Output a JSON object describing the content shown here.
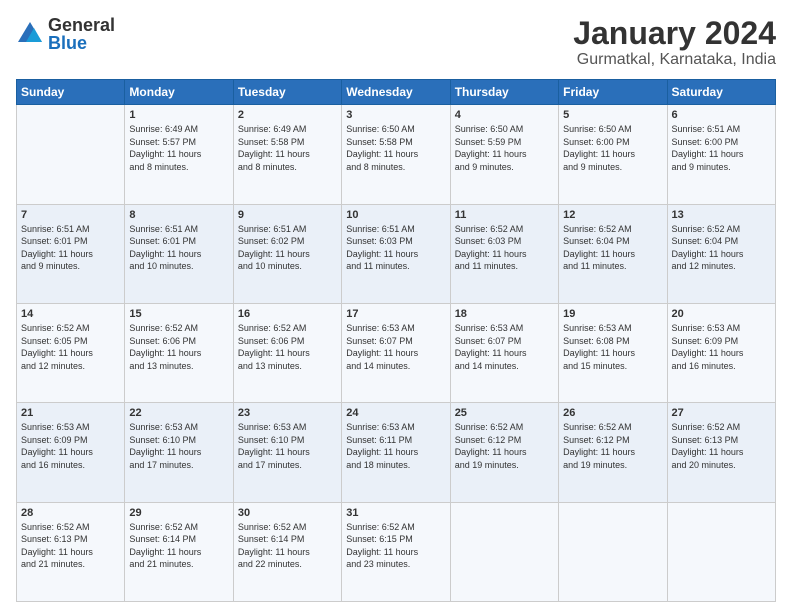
{
  "logo": {
    "general": "General",
    "blue": "Blue"
  },
  "header": {
    "month": "January 2024",
    "location": "Gurmatkal, Karnataka, India"
  },
  "days_of_week": [
    "Sunday",
    "Monday",
    "Tuesday",
    "Wednesday",
    "Thursday",
    "Friday",
    "Saturday"
  ],
  "weeks": [
    [
      {
        "day": "",
        "info": ""
      },
      {
        "day": "1",
        "info": "Sunrise: 6:49 AM\nSunset: 5:57 PM\nDaylight: 11 hours\nand 8 minutes."
      },
      {
        "day": "2",
        "info": "Sunrise: 6:49 AM\nSunset: 5:58 PM\nDaylight: 11 hours\nand 8 minutes."
      },
      {
        "day": "3",
        "info": "Sunrise: 6:50 AM\nSunset: 5:58 PM\nDaylight: 11 hours\nand 8 minutes."
      },
      {
        "day": "4",
        "info": "Sunrise: 6:50 AM\nSunset: 5:59 PM\nDaylight: 11 hours\nand 9 minutes."
      },
      {
        "day": "5",
        "info": "Sunrise: 6:50 AM\nSunset: 6:00 PM\nDaylight: 11 hours\nand 9 minutes."
      },
      {
        "day": "6",
        "info": "Sunrise: 6:51 AM\nSunset: 6:00 PM\nDaylight: 11 hours\nand 9 minutes."
      }
    ],
    [
      {
        "day": "7",
        "info": "Sunrise: 6:51 AM\nSunset: 6:01 PM\nDaylight: 11 hours\nand 9 minutes."
      },
      {
        "day": "8",
        "info": "Sunrise: 6:51 AM\nSunset: 6:01 PM\nDaylight: 11 hours\nand 10 minutes."
      },
      {
        "day": "9",
        "info": "Sunrise: 6:51 AM\nSunset: 6:02 PM\nDaylight: 11 hours\nand 10 minutes."
      },
      {
        "day": "10",
        "info": "Sunrise: 6:51 AM\nSunset: 6:03 PM\nDaylight: 11 hours\nand 11 minutes."
      },
      {
        "day": "11",
        "info": "Sunrise: 6:52 AM\nSunset: 6:03 PM\nDaylight: 11 hours\nand 11 minutes."
      },
      {
        "day": "12",
        "info": "Sunrise: 6:52 AM\nSunset: 6:04 PM\nDaylight: 11 hours\nand 11 minutes."
      },
      {
        "day": "13",
        "info": "Sunrise: 6:52 AM\nSunset: 6:04 PM\nDaylight: 11 hours\nand 12 minutes."
      }
    ],
    [
      {
        "day": "14",
        "info": "Sunrise: 6:52 AM\nSunset: 6:05 PM\nDaylight: 11 hours\nand 12 minutes."
      },
      {
        "day": "15",
        "info": "Sunrise: 6:52 AM\nSunset: 6:06 PM\nDaylight: 11 hours\nand 13 minutes."
      },
      {
        "day": "16",
        "info": "Sunrise: 6:52 AM\nSunset: 6:06 PM\nDaylight: 11 hours\nand 13 minutes."
      },
      {
        "day": "17",
        "info": "Sunrise: 6:53 AM\nSunset: 6:07 PM\nDaylight: 11 hours\nand 14 minutes."
      },
      {
        "day": "18",
        "info": "Sunrise: 6:53 AM\nSunset: 6:07 PM\nDaylight: 11 hours\nand 14 minutes."
      },
      {
        "day": "19",
        "info": "Sunrise: 6:53 AM\nSunset: 6:08 PM\nDaylight: 11 hours\nand 15 minutes."
      },
      {
        "day": "20",
        "info": "Sunrise: 6:53 AM\nSunset: 6:09 PM\nDaylight: 11 hours\nand 16 minutes."
      }
    ],
    [
      {
        "day": "21",
        "info": "Sunrise: 6:53 AM\nSunset: 6:09 PM\nDaylight: 11 hours\nand 16 minutes."
      },
      {
        "day": "22",
        "info": "Sunrise: 6:53 AM\nSunset: 6:10 PM\nDaylight: 11 hours\nand 17 minutes."
      },
      {
        "day": "23",
        "info": "Sunrise: 6:53 AM\nSunset: 6:10 PM\nDaylight: 11 hours\nand 17 minutes."
      },
      {
        "day": "24",
        "info": "Sunrise: 6:53 AM\nSunset: 6:11 PM\nDaylight: 11 hours\nand 18 minutes."
      },
      {
        "day": "25",
        "info": "Sunrise: 6:52 AM\nSunset: 6:12 PM\nDaylight: 11 hours\nand 19 minutes."
      },
      {
        "day": "26",
        "info": "Sunrise: 6:52 AM\nSunset: 6:12 PM\nDaylight: 11 hours\nand 19 minutes."
      },
      {
        "day": "27",
        "info": "Sunrise: 6:52 AM\nSunset: 6:13 PM\nDaylight: 11 hours\nand 20 minutes."
      }
    ],
    [
      {
        "day": "28",
        "info": "Sunrise: 6:52 AM\nSunset: 6:13 PM\nDaylight: 11 hours\nand 21 minutes."
      },
      {
        "day": "29",
        "info": "Sunrise: 6:52 AM\nSunset: 6:14 PM\nDaylight: 11 hours\nand 21 minutes."
      },
      {
        "day": "30",
        "info": "Sunrise: 6:52 AM\nSunset: 6:14 PM\nDaylight: 11 hours\nand 22 minutes."
      },
      {
        "day": "31",
        "info": "Sunrise: 6:52 AM\nSunset: 6:15 PM\nDaylight: 11 hours\nand 23 minutes."
      },
      {
        "day": "",
        "info": ""
      },
      {
        "day": "",
        "info": ""
      },
      {
        "day": "",
        "info": ""
      }
    ]
  ]
}
